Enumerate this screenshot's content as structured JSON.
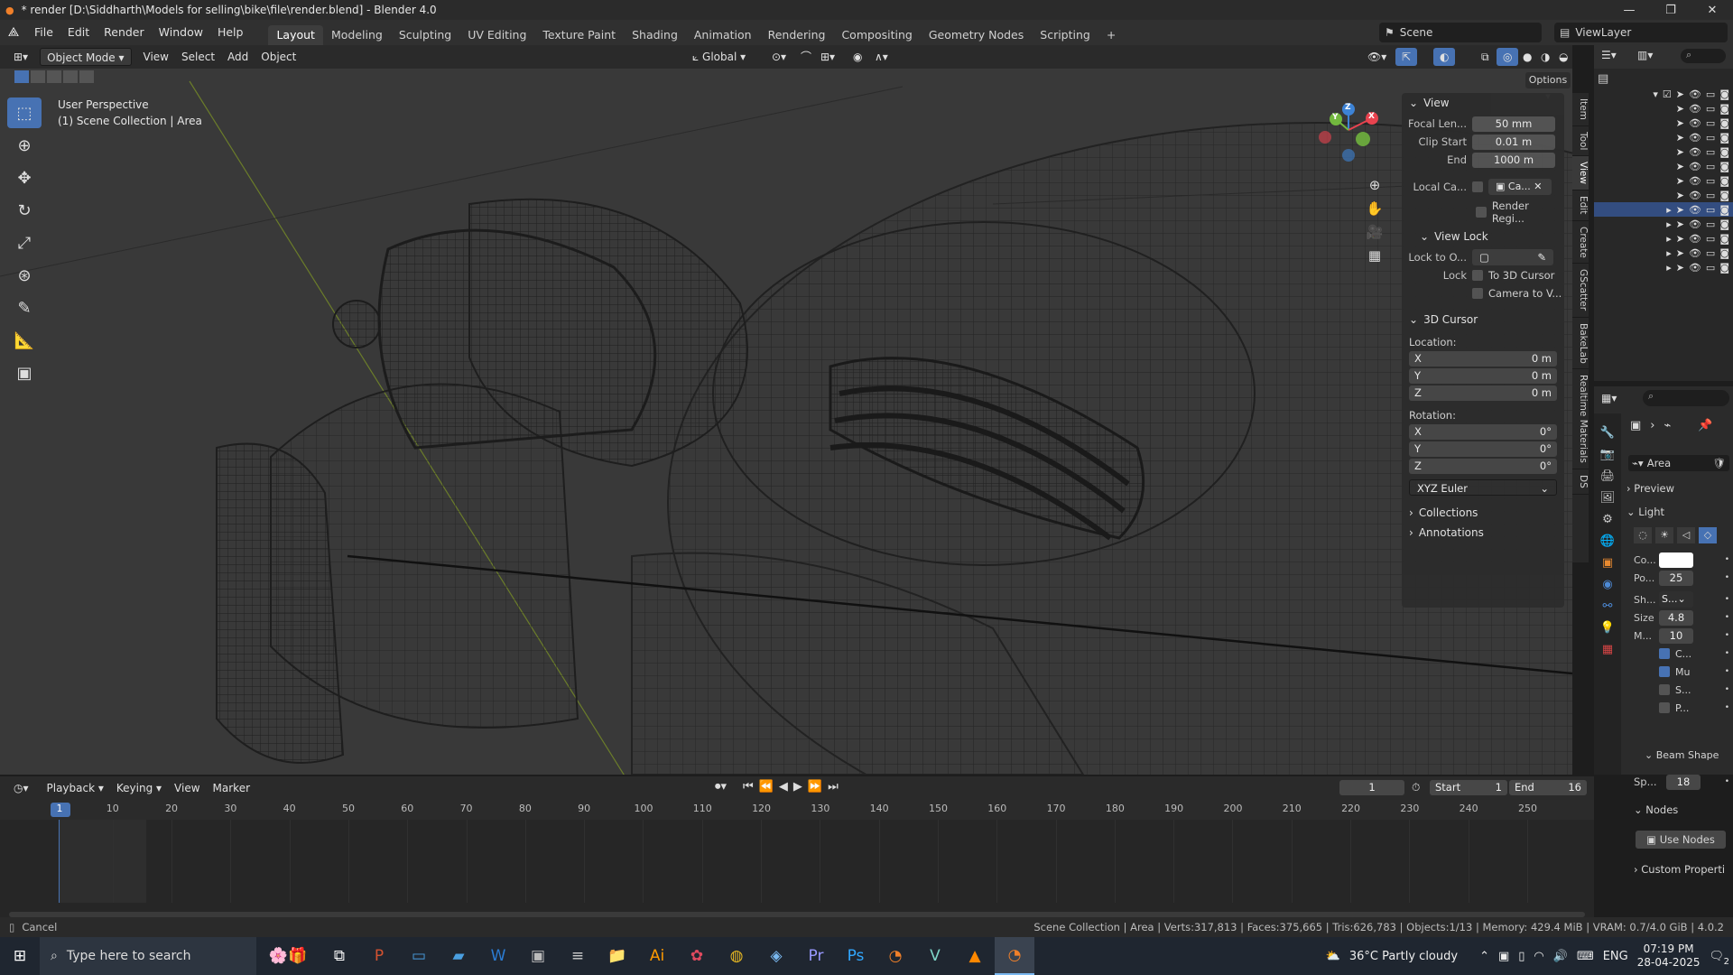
{
  "window": {
    "title": "* render [D:\\Siddharth\\Models for selling\\bike\\file\\render.blend] - Blender 4.0",
    "min": "—",
    "max": "❐",
    "close": "✕"
  },
  "menu": {
    "items": [
      "File",
      "Edit",
      "Render",
      "Window",
      "Help"
    ],
    "workspaces": [
      "Layout",
      "Modeling",
      "Sculpting",
      "UV Editing",
      "Texture Paint",
      "Shading",
      "Animation",
      "Rendering",
      "Compositing",
      "Geometry Nodes",
      "Scripting",
      "+"
    ],
    "scene": "Scene",
    "viewlayer": "ViewLayer"
  },
  "header3d": {
    "mode": "Object Mode",
    "menus": [
      "View",
      "Select",
      "Add",
      "Object"
    ],
    "orientation": "Global",
    "options": "Options"
  },
  "viewport": {
    "perspective": "User Perspective",
    "collection": "(1) Scene Collection | Area",
    "gizmo": {
      "x": "X",
      "y": "Y",
      "z": "Z"
    }
  },
  "npanel": {
    "view_title": "View",
    "focal_label": "Focal Len...",
    "focal_value": "50 mm",
    "clip_start_label": "Clip Start",
    "clip_start_value": "0.01 m",
    "clip_end_label": "End",
    "clip_end_value": "1000 m",
    "local_cam_label": "Local Ca...",
    "local_cam_value": "Ca...",
    "render_region": "Render Regi...",
    "viewlock_title": "View Lock",
    "lock_obj_label": "Lock to O...",
    "lock_label": "Lock",
    "to_cursor": "To 3D Cursor",
    "camera_to_view": "Camera to V...",
    "cursor_title": "3D Cursor",
    "location_label": "Location:",
    "loc": [
      {
        "axis": "X",
        "value": "0 m"
      },
      {
        "axis": "Y",
        "value": "0 m"
      },
      {
        "axis": "Z",
        "value": "0 m"
      }
    ],
    "rotation_label": "Rotation:",
    "rot": [
      {
        "axis": "X",
        "value": "0°"
      },
      {
        "axis": "Y",
        "value": "0°"
      },
      {
        "axis": "Z",
        "value": "0°"
      }
    ],
    "euler": "XYZ Euler",
    "collections": "Collections",
    "annotations": "Annotations"
  },
  "vtabs": [
    "Item",
    "Tool",
    "View",
    "Edit",
    "Create",
    "GScatter",
    "BakeLab",
    "Realtime Materials",
    "DS"
  ],
  "properties": {
    "object": "Area",
    "preview": "Preview",
    "light": "Light",
    "color_label": "Co...",
    "power_label": "Po...",
    "power_value": "25",
    "shape_label": "Sh...",
    "shape_value": "S...",
    "size_label": "Size",
    "size_value": "4.8",
    "max_label": "M...",
    "max_value": "10",
    "opt1": "C...",
    "opt2": "Mu",
    "opt3": "S...",
    "opt4": "P...",
    "beam_shape": "Beam Shape",
    "spread_label": "Sp...",
    "spread_value": "18",
    "nodes": "Nodes",
    "use_nodes": "Use Nodes",
    "custom_props": "Custom Properti"
  },
  "timeline": {
    "menus": [
      "Playback",
      "Keying",
      "View",
      "Marker"
    ],
    "current_frame": "1",
    "start_label": "Start",
    "start_value": "1",
    "end_label": "End",
    "end_value": "16",
    "ticks": [
      "1",
      "10",
      "20",
      "30",
      "40",
      "50",
      "60",
      "70",
      "80",
      "90",
      "100",
      "110",
      "120",
      "130",
      "140",
      "150",
      "160",
      "170",
      "180",
      "190",
      "200",
      "210",
      "220",
      "230",
      "240",
      "250"
    ]
  },
  "status": {
    "left": "Cancel",
    "right": "Scene Collection | Area | Verts:317,813 | Faces:375,665 | Tris:626,783 | Objects:1/13 | Memory: 429.4 MiB | VRAM: 0.7/4.0 GiB | 4.0.2"
  },
  "taskbar": {
    "search_placeholder": "Type here to search",
    "weather": "36°C  Partly cloudy",
    "lang": "ENG",
    "time": "07:19 PM",
    "date": "28-04-2025",
    "notif": "2"
  },
  "colors": {
    "accent": "#4772b3",
    "x_axis": "#e8434f",
    "y_axis": "#72b83e",
    "z_axis": "#3d83d6"
  }
}
